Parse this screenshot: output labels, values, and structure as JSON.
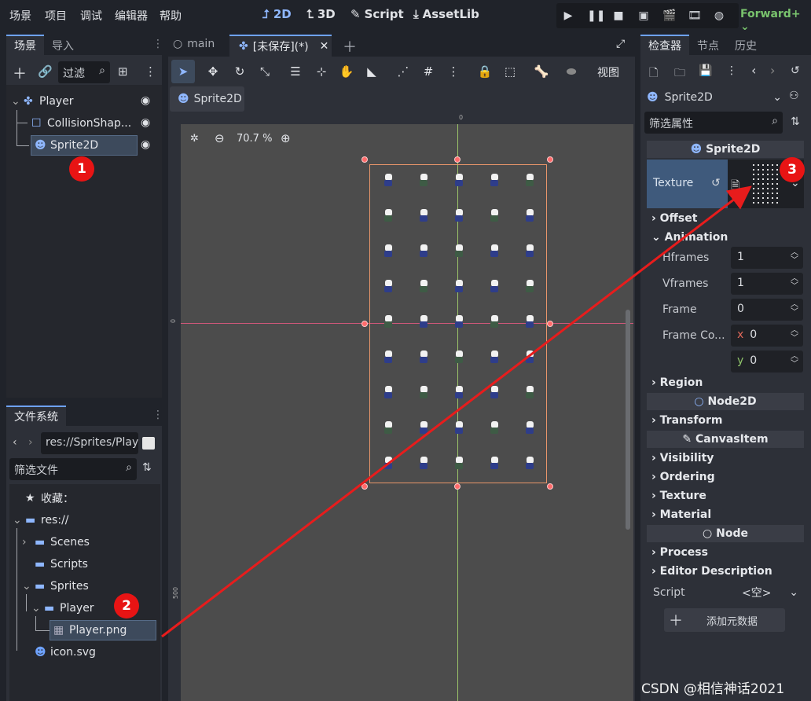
{
  "menubar": {
    "items": [
      "场景",
      "项目",
      "调试",
      "编辑器",
      "帮助"
    ],
    "workspaces": [
      {
        "label": "2D",
        "icon": "2d-icon",
        "active": true
      },
      {
        "label": "3D",
        "icon": "3d-icon",
        "active": false
      },
      {
        "label": "Script",
        "icon": "script-icon",
        "active": false
      },
      {
        "label": "AssetLib",
        "icon": "assetlib-icon",
        "active": false
      }
    ],
    "renderer": "Forward+"
  },
  "scene_dock": {
    "tabs": [
      "场景",
      "导入"
    ],
    "filter_placeholder": "过滤",
    "nodes": [
      {
        "label": "Player",
        "icon": "node2d-icon"
      },
      {
        "label": "CollisionShap...",
        "icon": "collision-shape-icon"
      },
      {
        "label": "Sprite2D",
        "icon": "sprite2d-icon",
        "selected": true
      }
    ]
  },
  "filesystem_dock": {
    "tab": "文件系统",
    "path": "res://Sprites/Play",
    "filter_placeholder": "筛选文件",
    "items": [
      {
        "label": "收藏：",
        "icon": "star-icon"
      },
      {
        "label": "res://",
        "icon": "folder-icon"
      },
      {
        "label": "Scenes",
        "icon": "folder-icon"
      },
      {
        "label": "Scripts",
        "icon": "folder-icon"
      },
      {
        "label": "Sprites",
        "icon": "folder-icon"
      },
      {
        "label": "Player",
        "icon": "folder-icon"
      },
      {
        "label": "Player.png",
        "icon": "image-icon",
        "selected": true
      },
      {
        "label": "icon.svg",
        "icon": "godot-icon"
      }
    ]
  },
  "editor": {
    "tabs": [
      {
        "label": "main",
        "icon": "circle-icon"
      },
      {
        "label": "[未保存](*)",
        "icon": "node2d-icon",
        "active": true
      }
    ],
    "toolbar_view_label": "视图",
    "breadcrumb": "Sprite2D",
    "zoom": "70.7 %",
    "ruler_labels": {
      "h_zero": "0",
      "v_zero": "0",
      "v_500": "500"
    },
    "sprite_grid": {
      "columns": 5,
      "rows": 9
    }
  },
  "inspector": {
    "tabs": [
      "检查器",
      "节点",
      "历史"
    ],
    "node_selector": "Sprite2D",
    "filter_placeholder": "筛选属性",
    "section_sprite": "Sprite2D",
    "texture_label": "Texture",
    "offset": "Offset",
    "animation": "Animation",
    "hframes_label": "Hframes",
    "hframes_value": "1",
    "vframes_label": "Vframes",
    "vframes_value": "1",
    "frame_label": "Frame",
    "frame_value": "0",
    "frame_coords_label": "Frame Co...",
    "frame_coords_x_label": "x",
    "frame_coords_x": "0",
    "frame_coords_y_label": "y",
    "frame_coords_y": "0",
    "region": "Region",
    "section_node2d": "Node2D",
    "transform": "Transform",
    "section_canvasitem": "CanvasItem",
    "visibility": "Visibility",
    "ordering": "Ordering",
    "texture_cat": "Texture",
    "material": "Material",
    "section_node": "Node",
    "process": "Process",
    "editor_description": "Editor Description",
    "script_label": "Script",
    "script_value": "<空>",
    "add_metadata": "添加元数据"
  },
  "annotations": {
    "badge_1": "1",
    "badge_2": "2",
    "badge_3": "3",
    "arrow_color": "#e81c1c",
    "badge_color": "#e81414"
  },
  "watermark": "CSDN @相信神话2021",
  "colors": {
    "accent": "#6ea2ff",
    "selection": "#3d4a5c",
    "renderer": "#79c36d",
    "sprite_frame": "#e8956a"
  }
}
